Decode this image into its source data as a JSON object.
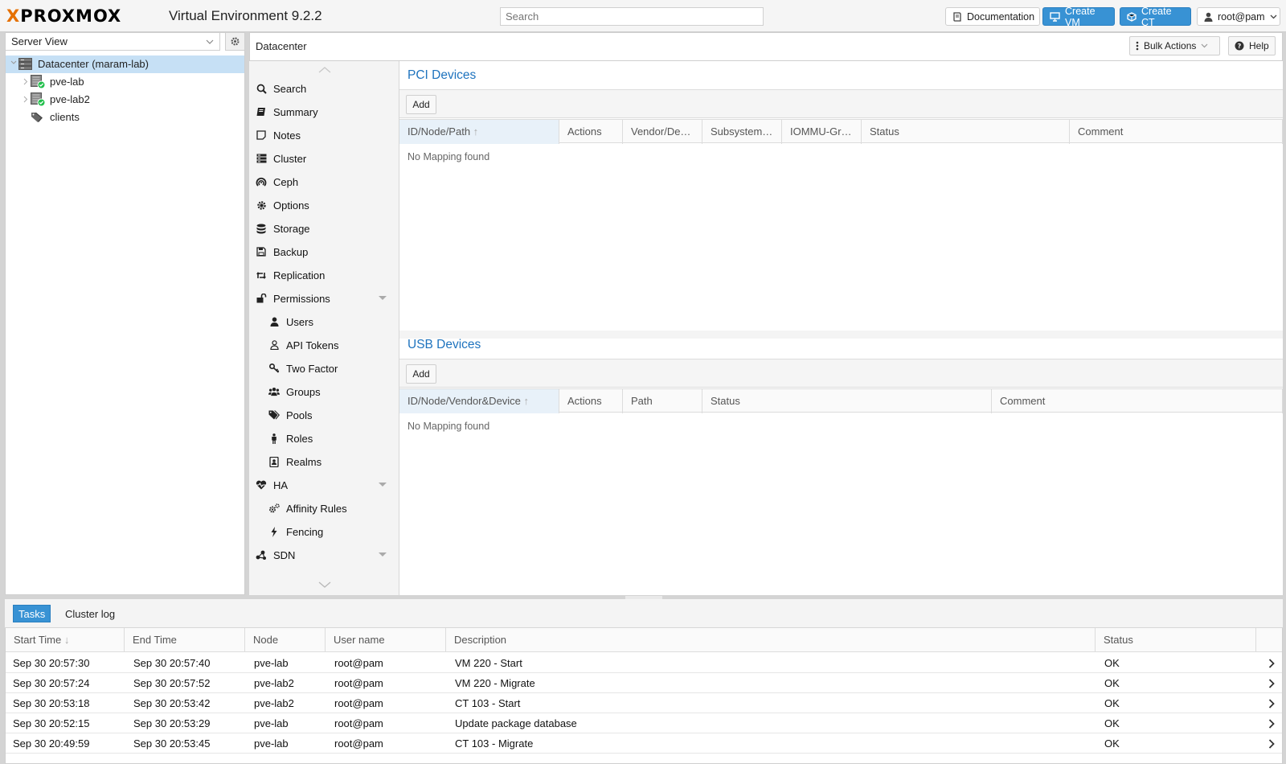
{
  "app": {
    "logo_text": "PROXMOX",
    "title": "Virtual Environment 9.2.2"
  },
  "search": {
    "placeholder": "Search"
  },
  "topbar": {
    "documentation": "Documentation",
    "create_vm": "Create VM",
    "create_ct": "Create CT",
    "user": "root@pam"
  },
  "resource_tree": {
    "view": "Server View",
    "items": [
      {
        "label": "Datacenter (maram-lab)",
        "icon": "datacenter-icon",
        "selected": true
      },
      {
        "label": "pve-lab",
        "icon": "node-online-icon"
      },
      {
        "label": "pve-lab2",
        "icon": "node-online-icon"
      },
      {
        "label": "clients",
        "icon": "tags-icon"
      }
    ]
  },
  "content_header": {
    "breadcrumb": "Datacenter",
    "bulk_actions": "Bulk Actions",
    "help": "Help"
  },
  "menu": {
    "items": [
      {
        "label": "Search",
        "icon": "search-icon"
      },
      {
        "label": "Summary",
        "icon": "book-icon"
      },
      {
        "label": "Notes",
        "icon": "sticky-note-icon"
      },
      {
        "label": "Cluster",
        "icon": "server-icon"
      },
      {
        "label": "Ceph",
        "icon": "ceph-icon"
      },
      {
        "label": "Options",
        "icon": "gear-icon"
      },
      {
        "label": "Storage",
        "icon": "database-icon"
      },
      {
        "label": "Backup",
        "icon": "floppy-icon"
      },
      {
        "label": "Replication",
        "icon": "retweet-icon"
      },
      {
        "label": "Permissions",
        "icon": "unlock-icon",
        "expandable": true
      },
      {
        "label": "Users",
        "icon": "user-icon",
        "sub": true
      },
      {
        "label": "API Tokens",
        "icon": "user-outline-icon",
        "sub": true
      },
      {
        "label": "Two Factor",
        "icon": "key-icon",
        "sub": true
      },
      {
        "label": "Groups",
        "icon": "users-icon",
        "sub": true
      },
      {
        "label": "Pools",
        "icon": "tags-icon",
        "sub": true
      },
      {
        "label": "Roles",
        "icon": "male-icon",
        "sub": true
      },
      {
        "label": "Realms",
        "icon": "address-book-icon",
        "sub": true
      },
      {
        "label": "HA",
        "icon": "heartbeat-icon",
        "expandable": true
      },
      {
        "label": "Affinity Rules",
        "icon": "cogs-icon",
        "sub": true
      },
      {
        "label": "Fencing",
        "icon": "bolt-icon",
        "sub": true
      },
      {
        "label": "SDN",
        "icon": "sdn-icon",
        "expandable": true
      }
    ]
  },
  "pci": {
    "title": "PCI Devices",
    "add": "Add",
    "columns": [
      "ID/Node/Path",
      "Actions",
      "Vendor/De…",
      "Subsystem…",
      "IOMMU-Gr…",
      "Status",
      "Comment"
    ],
    "empty": "No Mapping found"
  },
  "usb": {
    "title": "USB Devices",
    "add": "Add",
    "columns": [
      "ID/Node/Vendor&Device",
      "Actions",
      "Path",
      "Status",
      "Comment"
    ],
    "empty": "No Mapping found"
  },
  "bottom": {
    "tabs": [
      "Tasks",
      "Cluster log"
    ],
    "columns": [
      "Start Time",
      "End Time",
      "Node",
      "User name",
      "Description",
      "Status"
    ],
    "rows": [
      [
        "Sep 30 20:57:30",
        "Sep 30 20:57:40",
        "pve-lab",
        "root@pam",
        "VM 220 - Start",
        "OK"
      ],
      [
        "Sep 30 20:57:24",
        "Sep 30 20:57:52",
        "pve-lab2",
        "root@pam",
        "VM 220 - Migrate",
        "OK"
      ],
      [
        "Sep 30 20:53:18",
        "Sep 30 20:53:42",
        "pve-lab2",
        "root@pam",
        "CT 103 - Start",
        "OK"
      ],
      [
        "Sep 30 20:52:15",
        "Sep 30 20:53:29",
        "pve-lab",
        "root@pam",
        "Update package database",
        "OK"
      ],
      [
        "Sep 30 20:49:59",
        "Sep 30 20:53:45",
        "pve-lab",
        "root@pam",
        "CT 103 - Migrate",
        "OK"
      ]
    ]
  }
}
